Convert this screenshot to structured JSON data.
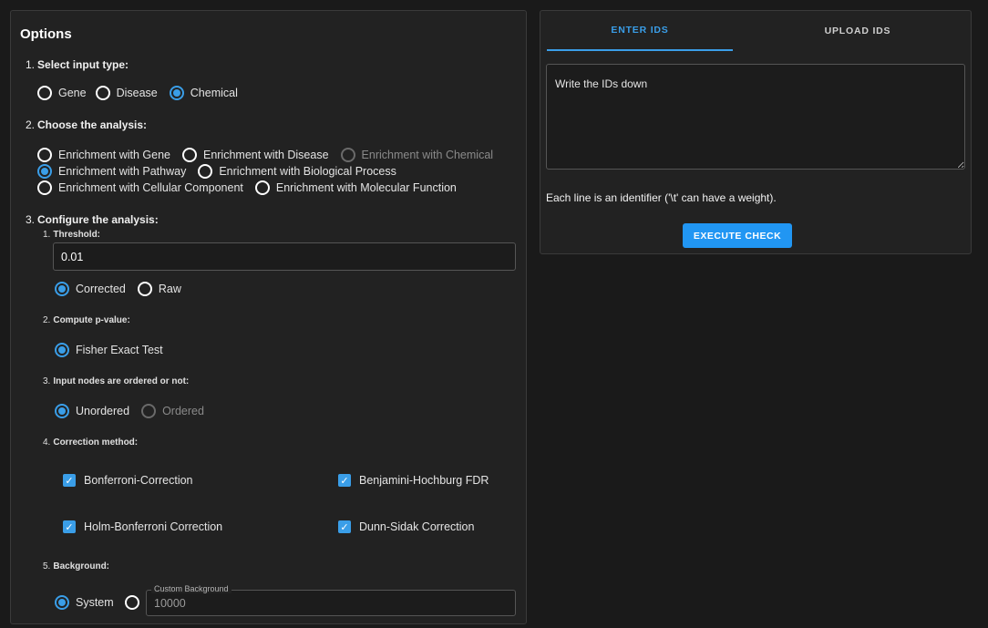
{
  "options": {
    "title": "Options",
    "input_type": {
      "number": "1.",
      "label": "Select input type:",
      "options": [
        {
          "label": "Gene",
          "checked": false
        },
        {
          "label": "Disease",
          "checked": false
        },
        {
          "label": "Chemical",
          "checked": true
        }
      ]
    },
    "analysis": {
      "number": "2.",
      "label": "Choose the analysis:",
      "options": [
        {
          "label": "Enrichment with Gene",
          "checked": false,
          "disabled": false
        },
        {
          "label": "Enrichment with Disease",
          "checked": false,
          "disabled": false
        },
        {
          "label": "Enrichment with Chemical",
          "checked": false,
          "disabled": true
        },
        {
          "label": "Enrichment with Pathway",
          "checked": true,
          "disabled": false
        },
        {
          "label": "Enrichment with Biological Process",
          "checked": false,
          "disabled": false
        },
        {
          "label": "Enrichment with Cellular Component",
          "checked": false,
          "disabled": false
        },
        {
          "label": "Enrichment with Molecular Function",
          "checked": false,
          "disabled": false
        }
      ]
    },
    "configure": {
      "number": "3.",
      "label": "Configure the analysis:",
      "threshold": {
        "number": "1.",
        "label": "Threshold:",
        "value": "0.01",
        "options": [
          {
            "label": "Corrected",
            "checked": true
          },
          {
            "label": "Raw",
            "checked": false
          }
        ]
      },
      "pvalue": {
        "number": "2.",
        "label": "Compute p-value:",
        "options": [
          {
            "label": "Fisher Exact Test",
            "checked": true
          }
        ]
      },
      "ordered": {
        "number": "3.",
        "label": "Input nodes are ordered or not:",
        "options": [
          {
            "label": "Unordered",
            "checked": true,
            "disabled": false
          },
          {
            "label": "Ordered",
            "checked": false,
            "disabled": true
          }
        ]
      },
      "correction": {
        "number": "4.",
        "label": "Correction method:",
        "options": [
          {
            "label": "Bonferroni-Correction",
            "checked": true
          },
          {
            "label": "Benjamini-Hochburg FDR",
            "checked": true
          },
          {
            "label": "Holm-Bonferroni Correction",
            "checked": true
          },
          {
            "label": "Dunn-Sidak Correction",
            "checked": true
          }
        ]
      },
      "background": {
        "number": "5.",
        "label": "Background:",
        "system_label": "System",
        "system_checked": true,
        "custom_checked": false,
        "custom_field_label": "Custom Background",
        "custom_placeholder": "10000"
      }
    }
  },
  "ids": {
    "tabs": [
      {
        "label": "ENTER IDS",
        "active": true
      },
      {
        "label": "UPLOAD IDS",
        "active": false
      }
    ],
    "textarea_placeholder": "Write the IDs down",
    "hint": "Each line is an identifier ('\\t' can have a weight).",
    "execute_label": "EXECUTE CHECK"
  },
  "colors": {
    "accent": "#3a9ee8",
    "button": "#2196f3",
    "background": "#1a1a1a",
    "panel": "#222222"
  }
}
